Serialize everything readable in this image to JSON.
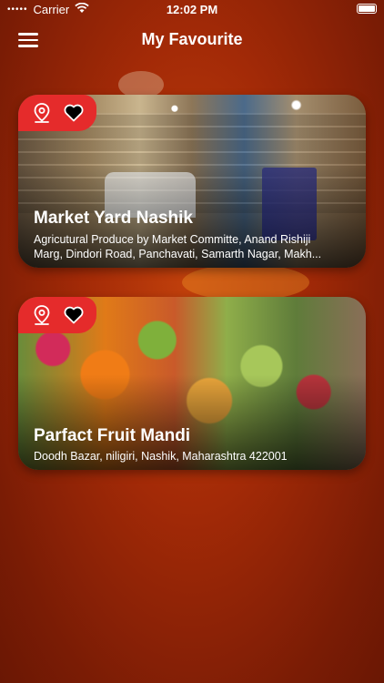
{
  "status_bar": {
    "carrier": "Carrier",
    "time": "12:02 PM"
  },
  "header": {
    "title": "My Favourite",
    "menu_icon": "menu-icon"
  },
  "favourites": [
    {
      "title": "Market Yard Nashik",
      "address_line1": "Agricutural Produce by Market Committe, Anand Rishiji",
      "address_line2": "Marg, Dindori Road, Panchavati, Samarth Nagar, Makh...",
      "icons": [
        "location-pin-icon",
        "heart-icon"
      ]
    },
    {
      "title": "Parfact Fruit Mandi",
      "address": "Doodh Bazar, niligiri, Nashik, Maharashtra 422001",
      "icons": [
        "location-pin-icon",
        "heart-icon"
      ]
    }
  ],
  "colors": {
    "badge": "#e52b2b",
    "background": "#a32a07"
  }
}
